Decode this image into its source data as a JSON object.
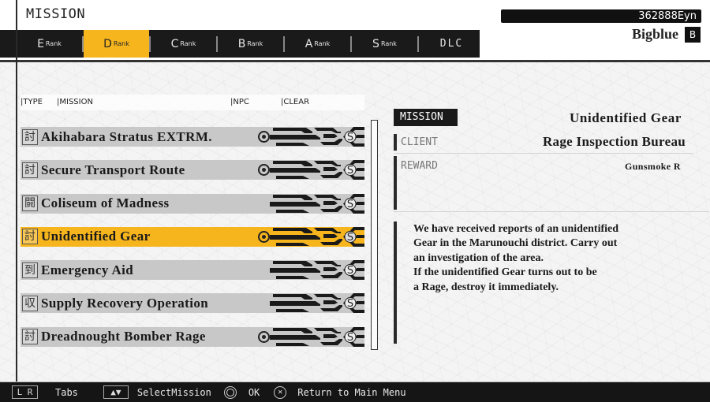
{
  "header": {
    "title": "MISSION",
    "money": "362888Eyn",
    "player_name": "Bigblue",
    "player_rank": "B"
  },
  "tabs": [
    {
      "big": "E",
      "small": "Rank",
      "active": false
    },
    {
      "big": "D",
      "small": "Rank",
      "active": true
    },
    {
      "big": "C",
      "small": "Rank",
      "active": false
    },
    {
      "big": "B",
      "small": "Rank",
      "active": false
    },
    {
      "big": "A",
      "small": "Rank",
      "active": false
    },
    {
      "big": "S",
      "small": "Rank",
      "active": false
    },
    {
      "big": "DLC",
      "small": "",
      "active": false
    }
  ],
  "columns": {
    "type": "|TYPE",
    "mission": "|MISSION",
    "npc": "|NPC",
    "clear": "|CLEAR"
  },
  "missions": [
    {
      "type_icon": "討",
      "name": "Akihabara Stratus EXTRM.",
      "npc": true,
      "clear": "S",
      "selected": false
    },
    {
      "type_icon": "討",
      "name": "Secure Transport Route",
      "npc": true,
      "clear": "S",
      "selected": false
    },
    {
      "type_icon": "闘",
      "name": "Coliseum of Madness",
      "npc": false,
      "clear": "S",
      "selected": false
    },
    {
      "type_icon": "討",
      "name": "Unidentified Gear",
      "npc": true,
      "clear": "S",
      "selected": true
    },
    {
      "type_icon": "到",
      "name": "Emergency Aid",
      "npc": false,
      "clear": "S",
      "selected": false
    },
    {
      "type_icon": "収",
      "name": "Supply Recovery Operation",
      "npc": false,
      "clear": "S",
      "selected": false
    },
    {
      "type_icon": "討",
      "name": "Dreadnought Bomber Rage",
      "npc": true,
      "clear": "S",
      "selected": false
    }
  ],
  "detail": {
    "mission_label": "MISSION",
    "mission_value": "Unidentified Gear",
    "client_label": "CLIENT",
    "client_value": "Rage Inspection Bureau",
    "reward_label": "REWARD",
    "reward_value": "Gunsmoke R",
    "description_lines": [
      "We have received reports of an unidentified",
      "Gear in the Marunouchi district. Carry out",
      "an investigation of the area.",
      "If the unidentified Gear turns out to be",
      "a Rage, destroy it immediately."
    ]
  },
  "footer": {
    "lr_key": "L R",
    "tabs_label": "Tabs",
    "updown_key": "▲▼",
    "select_label": "SelectMission",
    "ok_label": "OK",
    "x_key": "✕",
    "return_label": "Return to Main Menu"
  },
  "colors": {
    "accent": "#f6b51d",
    "dark": "#1a1a1a",
    "row_bg": "#c8c8c8"
  }
}
